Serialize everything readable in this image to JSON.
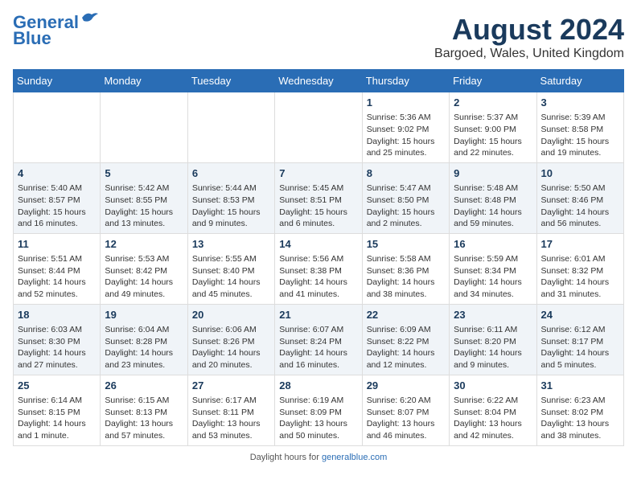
{
  "header": {
    "logo_line1": "General",
    "logo_line2": "Blue",
    "main_title": "August 2024",
    "subtitle": "Bargoed, Wales, United Kingdom"
  },
  "days_of_week": [
    "Sunday",
    "Monday",
    "Tuesday",
    "Wednesday",
    "Thursday",
    "Friday",
    "Saturday"
  ],
  "weeks": [
    [
      {
        "day": "",
        "info": ""
      },
      {
        "day": "",
        "info": ""
      },
      {
        "day": "",
        "info": ""
      },
      {
        "day": "",
        "info": ""
      },
      {
        "day": "1",
        "info": "Sunrise: 5:36 AM\nSunset: 9:02 PM\nDaylight: 15 hours\nand 25 minutes."
      },
      {
        "day": "2",
        "info": "Sunrise: 5:37 AM\nSunset: 9:00 PM\nDaylight: 15 hours\nand 22 minutes."
      },
      {
        "day": "3",
        "info": "Sunrise: 5:39 AM\nSunset: 8:58 PM\nDaylight: 15 hours\nand 19 minutes."
      }
    ],
    [
      {
        "day": "4",
        "info": "Sunrise: 5:40 AM\nSunset: 8:57 PM\nDaylight: 15 hours\nand 16 minutes."
      },
      {
        "day": "5",
        "info": "Sunrise: 5:42 AM\nSunset: 8:55 PM\nDaylight: 15 hours\nand 13 minutes."
      },
      {
        "day": "6",
        "info": "Sunrise: 5:44 AM\nSunset: 8:53 PM\nDaylight: 15 hours\nand 9 minutes."
      },
      {
        "day": "7",
        "info": "Sunrise: 5:45 AM\nSunset: 8:51 PM\nDaylight: 15 hours\nand 6 minutes."
      },
      {
        "day": "8",
        "info": "Sunrise: 5:47 AM\nSunset: 8:50 PM\nDaylight: 15 hours\nand 2 minutes."
      },
      {
        "day": "9",
        "info": "Sunrise: 5:48 AM\nSunset: 8:48 PM\nDaylight: 14 hours\nand 59 minutes."
      },
      {
        "day": "10",
        "info": "Sunrise: 5:50 AM\nSunset: 8:46 PM\nDaylight: 14 hours\nand 56 minutes."
      }
    ],
    [
      {
        "day": "11",
        "info": "Sunrise: 5:51 AM\nSunset: 8:44 PM\nDaylight: 14 hours\nand 52 minutes."
      },
      {
        "day": "12",
        "info": "Sunrise: 5:53 AM\nSunset: 8:42 PM\nDaylight: 14 hours\nand 49 minutes."
      },
      {
        "day": "13",
        "info": "Sunrise: 5:55 AM\nSunset: 8:40 PM\nDaylight: 14 hours\nand 45 minutes."
      },
      {
        "day": "14",
        "info": "Sunrise: 5:56 AM\nSunset: 8:38 PM\nDaylight: 14 hours\nand 41 minutes."
      },
      {
        "day": "15",
        "info": "Sunrise: 5:58 AM\nSunset: 8:36 PM\nDaylight: 14 hours\nand 38 minutes."
      },
      {
        "day": "16",
        "info": "Sunrise: 5:59 AM\nSunset: 8:34 PM\nDaylight: 14 hours\nand 34 minutes."
      },
      {
        "day": "17",
        "info": "Sunrise: 6:01 AM\nSunset: 8:32 PM\nDaylight: 14 hours\nand 31 minutes."
      }
    ],
    [
      {
        "day": "18",
        "info": "Sunrise: 6:03 AM\nSunset: 8:30 PM\nDaylight: 14 hours\nand 27 minutes."
      },
      {
        "day": "19",
        "info": "Sunrise: 6:04 AM\nSunset: 8:28 PM\nDaylight: 14 hours\nand 23 minutes."
      },
      {
        "day": "20",
        "info": "Sunrise: 6:06 AM\nSunset: 8:26 PM\nDaylight: 14 hours\nand 20 minutes."
      },
      {
        "day": "21",
        "info": "Sunrise: 6:07 AM\nSunset: 8:24 PM\nDaylight: 14 hours\nand 16 minutes."
      },
      {
        "day": "22",
        "info": "Sunrise: 6:09 AM\nSunset: 8:22 PM\nDaylight: 14 hours\nand 12 minutes."
      },
      {
        "day": "23",
        "info": "Sunrise: 6:11 AM\nSunset: 8:20 PM\nDaylight: 14 hours\nand 9 minutes."
      },
      {
        "day": "24",
        "info": "Sunrise: 6:12 AM\nSunset: 8:17 PM\nDaylight: 14 hours\nand 5 minutes."
      }
    ],
    [
      {
        "day": "25",
        "info": "Sunrise: 6:14 AM\nSunset: 8:15 PM\nDaylight: 14 hours\nand 1 minute."
      },
      {
        "day": "26",
        "info": "Sunrise: 6:15 AM\nSunset: 8:13 PM\nDaylight: 13 hours\nand 57 minutes."
      },
      {
        "day": "27",
        "info": "Sunrise: 6:17 AM\nSunset: 8:11 PM\nDaylight: 13 hours\nand 53 minutes."
      },
      {
        "day": "28",
        "info": "Sunrise: 6:19 AM\nSunset: 8:09 PM\nDaylight: 13 hours\nand 50 minutes."
      },
      {
        "day": "29",
        "info": "Sunrise: 6:20 AM\nSunset: 8:07 PM\nDaylight: 13 hours\nand 46 minutes."
      },
      {
        "day": "30",
        "info": "Sunrise: 6:22 AM\nSunset: 8:04 PM\nDaylight: 13 hours\nand 42 minutes."
      },
      {
        "day": "31",
        "info": "Sunrise: 6:23 AM\nSunset: 8:02 PM\nDaylight: 13 hours\nand 38 minutes."
      }
    ]
  ],
  "footer": {
    "text": "Daylight hours",
    "url_text": "generalblue.com"
  }
}
